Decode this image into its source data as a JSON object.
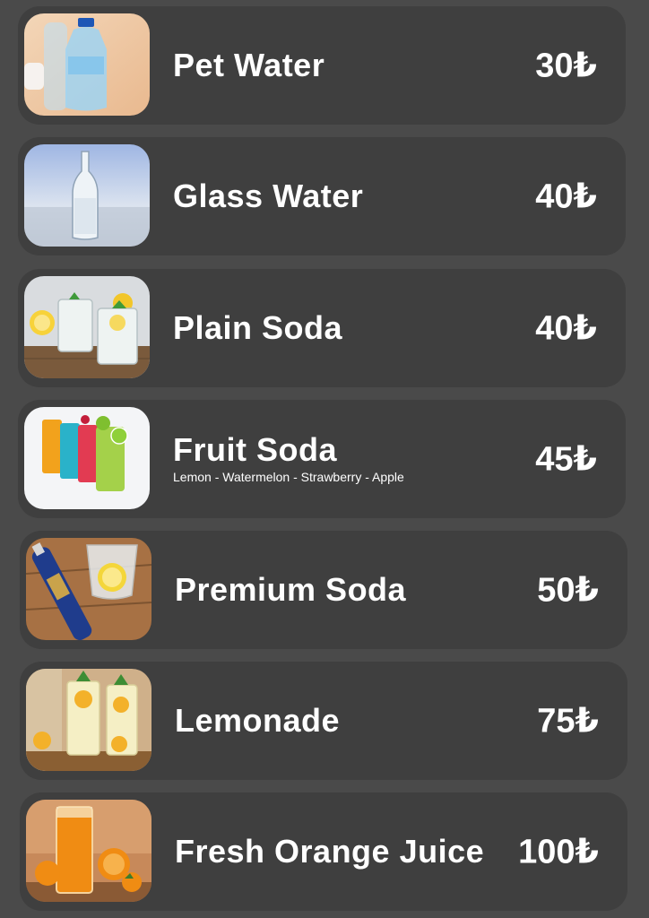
{
  "currency_symbol": "₺",
  "items": [
    {
      "name": "Pet Water",
      "price": "30₺",
      "image": "pet-water-bottle"
    },
    {
      "name": "Glass Water",
      "price": "40₺",
      "image": "glass-water-bottle"
    },
    {
      "name": "Plain Soda",
      "price": "40₺",
      "image": "plain-soda-glasses"
    },
    {
      "name": "Fruit Soda",
      "subtitle": "Lemon - Watermelon - Strawberry -  Apple",
      "price": "45₺",
      "image": "fruit-soda-glasses"
    },
    {
      "name": "Premium Soda",
      "price": "50₺",
      "image": "premium-soda-bottle"
    },
    {
      "name": "Lemonade",
      "price": "75₺",
      "image": "lemonade-glasses"
    },
    {
      "name": "Fresh Orange Juice",
      "price": "100₺",
      "image": "orange-juice-glass"
    }
  ],
  "colors": {
    "page_background": "#4a4a4a",
    "card_background": "#3f3f3f",
    "text": "#ffffff"
  }
}
